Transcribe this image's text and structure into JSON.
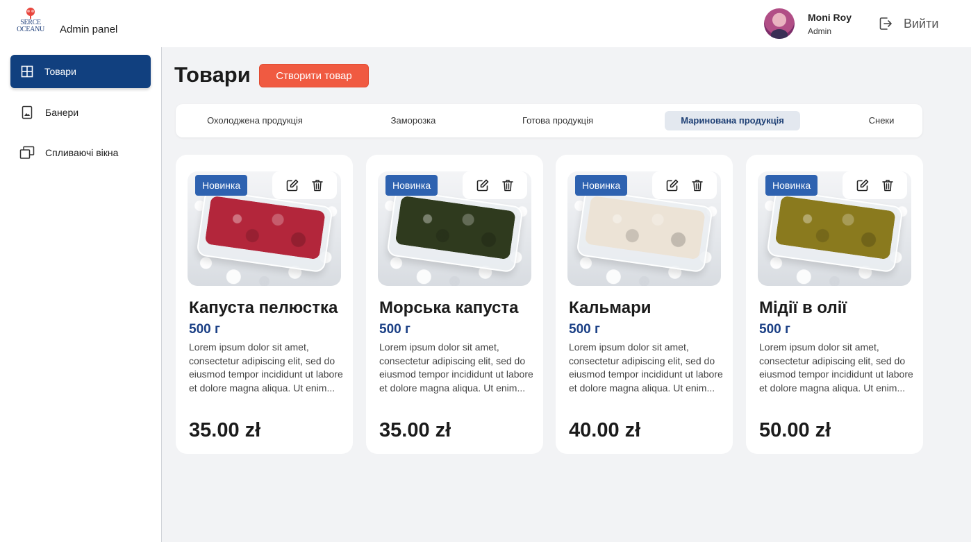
{
  "brand": {
    "logo_line1": "SERCE",
    "logo_line2": "OCEANU",
    "panel_title": "Admin panel"
  },
  "user": {
    "name": "Moni Roy",
    "role": "Admin",
    "logout_label": "Вийти"
  },
  "sidebar": {
    "items": [
      {
        "label": "Товари",
        "icon": "grid-icon",
        "active": true
      },
      {
        "label": "Банери",
        "icon": "image-frame-icon",
        "active": false
      },
      {
        "label": "Спливаючі вікна",
        "icon": "windows-icon",
        "active": false
      }
    ]
  },
  "main": {
    "title": "Товари",
    "create_button": "Створити товар",
    "tabs": [
      {
        "label": "Охолоджена продукція",
        "active": false
      },
      {
        "label": "Заморозка",
        "active": false
      },
      {
        "label": "Готова продукція",
        "active": false
      },
      {
        "label": "Маринована продукція",
        "active": true
      },
      {
        "label": "Снеки",
        "active": false
      }
    ],
    "products": [
      {
        "badge": "Новинка",
        "name": "Капуста пелюстка",
        "weight": "500 г",
        "description": "Lorem ipsum dolor sit amet, consectetur adipiscing elit, sed do eiusmod tempor incididunt ut labore et dolore magna aliqua. Ut enim...",
        "price": "35.00 zł",
        "food_color": "#b3263b"
      },
      {
        "badge": "Новинка",
        "name": "Морська капуста",
        "weight": "500 г",
        "description": "Lorem ipsum dolor sit amet, consectetur adipiscing elit, sed do eiusmod tempor incididunt ut labore et dolore magna aliqua. Ut enim...",
        "price": "35.00 zł",
        "food_color": "#2f3a1e"
      },
      {
        "badge": "Новинка",
        "name": "Кальмари",
        "weight": "500 г",
        "description": "Lorem ipsum dolor sit amet, consectetur adipiscing elit, sed do eiusmod tempor incididunt ut labore et dolore magna aliqua. Ut enim...",
        "price": "40.00 zł",
        "food_color": "#ece3d6"
      },
      {
        "badge": "Новинка",
        "name": "Мідії в олії",
        "weight": "500 г",
        "description": "Lorem ipsum dolor sit amet, consectetur adipiscing elit, sed do eiusmod tempor incididunt ut labore et dolore magna aliqua. Ut enim...",
        "price": "50.00 zł",
        "food_color": "#8a7a1e"
      }
    ]
  },
  "colors": {
    "accent": "#f05a41",
    "primary": "#11407f",
    "badge": "#2e62b0",
    "weight": "#1a3f85"
  }
}
